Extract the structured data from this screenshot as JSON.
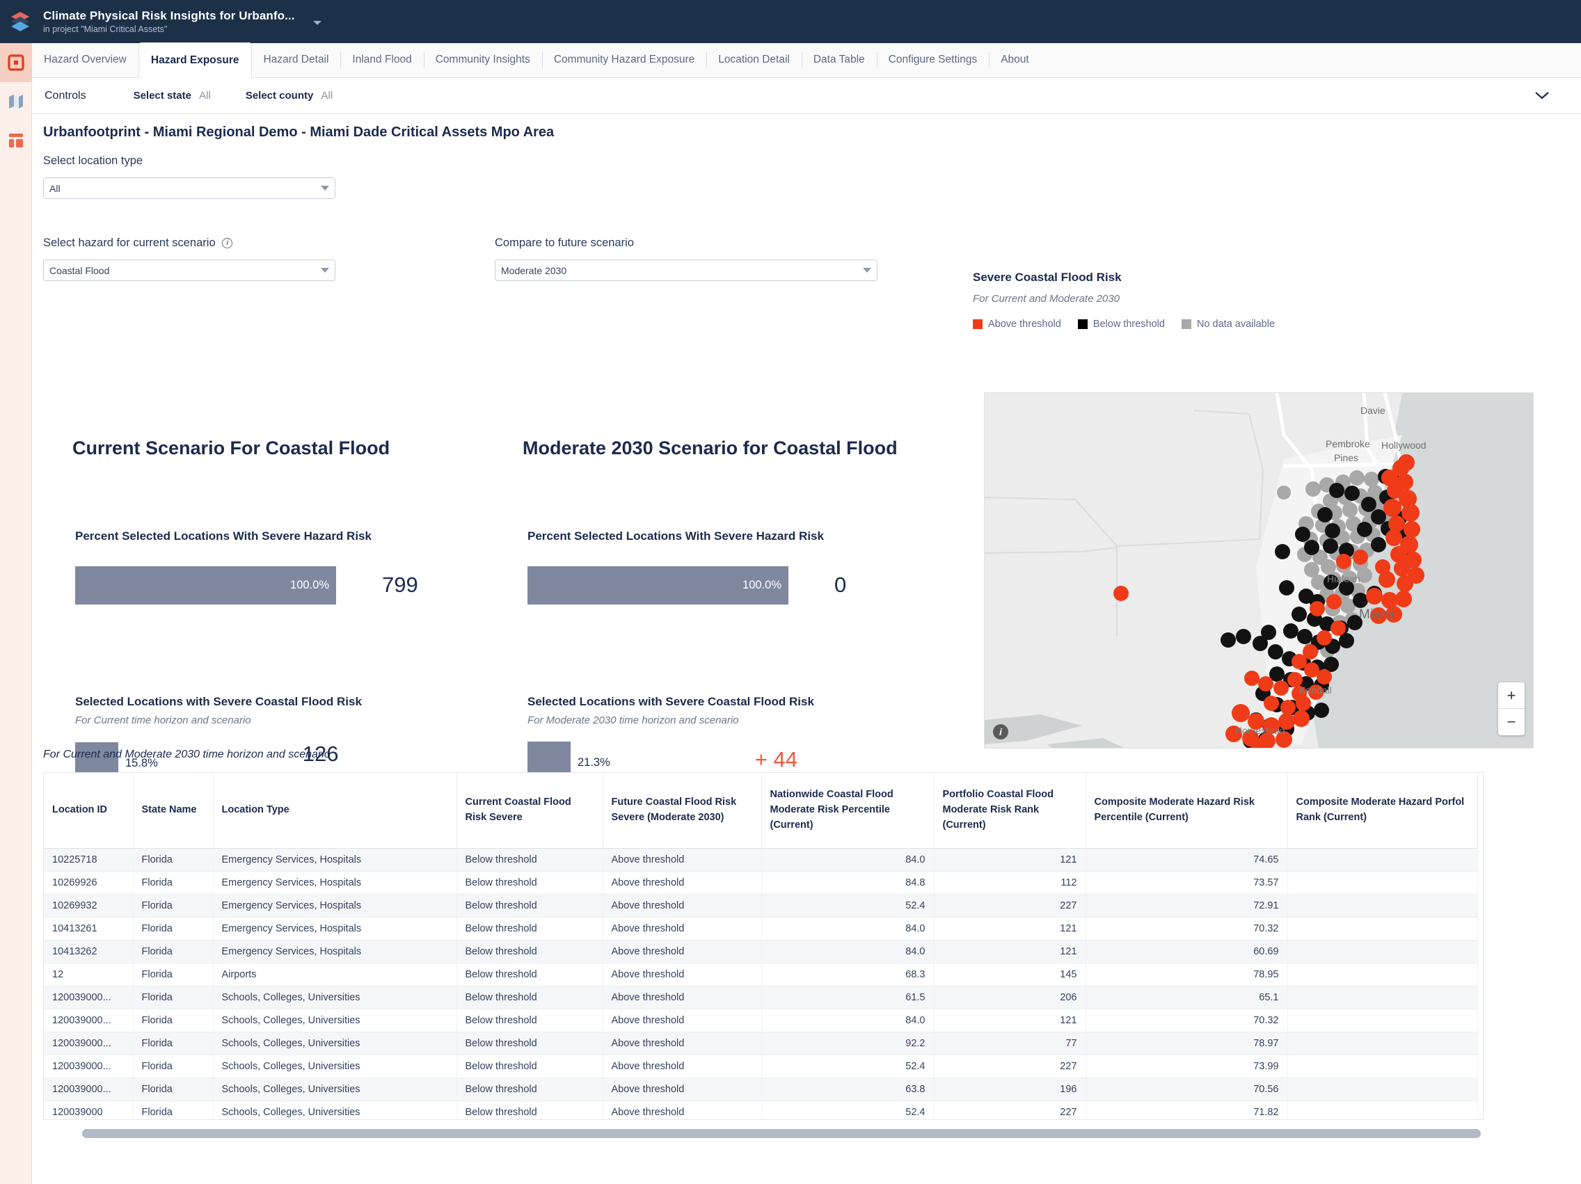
{
  "app": {
    "title": "Climate Physical Risk Insights for Urbanfo...",
    "subtitle": "in project \"Miami Critical Assets\"",
    "logo_icon": "layers-logo-icon",
    "title_caret_icon": "caret-down-icon"
  },
  "rail": {
    "items": [
      {
        "icon": "square-target-icon",
        "active": true
      },
      {
        "icon": "map-fold-icon",
        "active": false
      },
      {
        "icon": "dashboard-layout-icon",
        "active": false
      }
    ]
  },
  "tabs": [
    {
      "label": "Hazard Overview",
      "active": false
    },
    {
      "label": "Hazard Exposure",
      "active": true
    },
    {
      "label": "Hazard Detail",
      "active": false
    },
    {
      "label": "Inland Flood",
      "active": false
    },
    {
      "label": "Community Insights",
      "active": false
    },
    {
      "label": "Community Hazard Exposure",
      "active": false
    },
    {
      "label": "Location Detail",
      "active": false
    },
    {
      "label": "Data Table",
      "active": false
    },
    {
      "label": "Configure Settings",
      "active": false
    },
    {
      "label": "About",
      "active": false
    }
  ],
  "controls": {
    "label": "Controls",
    "filters": [
      {
        "name": "Select state",
        "value": "All"
      },
      {
        "name": "Select county",
        "value": "All"
      }
    ],
    "collapse_icon": "chevron-down-icon"
  },
  "page": {
    "title": "Urbanfootprint - Miami Regional Demo - Miami Dade Critical Assets Mpo Area"
  },
  "filters": {
    "location_type": {
      "label": "Select location type",
      "value": "All"
    },
    "hazard_current": {
      "label": "Select hazard for current scenario",
      "value": "Coastal Flood",
      "info_icon": "info-circle-icon"
    },
    "future_scenario": {
      "label": "Compare to future scenario",
      "value": "Moderate 2030"
    }
  },
  "scenarios": [
    {
      "heading": "Current Scenario For Coastal Flood",
      "kpi1": {
        "title": "Percent Selected Locations With Severe Hazard Risk",
        "bar_percent": "100.0%",
        "bar_fill": 100,
        "value": "799"
      },
      "kpi2": {
        "title": "Selected Locations with Severe Coastal Flood Risk",
        "subtitle": "For Current time horizon and scenario",
        "bar_percent": "15.8%",
        "bar_fill": 15.8,
        "value": "126",
        "value_is_delta": false
      }
    },
    {
      "heading": "Moderate 2030 Scenario for Coastal Flood",
      "kpi1": {
        "title": "Percent Selected Locations With Severe Hazard Risk",
        "bar_percent": "100.0%",
        "bar_fill": 100,
        "value": "0"
      },
      "kpi2": {
        "title": "Selected Locations with Severe Coastal Flood Risk",
        "subtitle": "For Moderate 2030 time horizon and scenario",
        "bar_percent": "21.3%",
        "bar_fill": 21.3,
        "value": "+ 44",
        "value_is_delta": true
      }
    }
  ],
  "map": {
    "title": "Severe Coastal Flood Risk",
    "subtitle": "For Current and Moderate 2030",
    "legend": [
      {
        "label": "Above threshold",
        "color": "#ef3b18"
      },
      {
        "label": "Below threshold",
        "color": "#000000"
      },
      {
        "label": "No data available",
        "color": "#a8a8a8"
      }
    ],
    "city_labels": [
      "Davie",
      "Pembroke Pines",
      "Hollywood",
      "Hialeah",
      "Miami",
      "Kendall",
      "Homestead"
    ],
    "zoom_in_icon": "plus-icon",
    "zoom_out_icon": "minus-icon",
    "zoom_in_label": "+",
    "zoom_out_label": "−",
    "attribution_icon": "info-icon"
  },
  "table": {
    "caption": "For Current and Moderate 2030 time horizon and scenario",
    "columns": [
      "Location ID",
      "State Name",
      "Location Type",
      "Current Coastal Flood Risk Severe",
      "Future Coastal Flood Risk Severe (Moderate 2030)",
      "Nationwide Coastal Flood Moderate Risk Percentile (Current)",
      "Portfolio Coastal Flood Moderate Risk Rank (Current)",
      "Composite Moderate Hazard Risk Percentile (Current)",
      "Composite Moderate Hazard Porfol Rank (Current)"
    ],
    "rows": [
      [
        "10225718",
        "Florida",
        "Emergency Services, Hospitals",
        "Below threshold",
        "Above threshold",
        "84.0",
        "121",
        "74.65",
        ""
      ],
      [
        "10269926",
        "Florida",
        "Emergency Services, Hospitals",
        "Below threshold",
        "Above threshold",
        "84.8",
        "112",
        "73.57",
        ""
      ],
      [
        "10269932",
        "Florida",
        "Emergency Services, Hospitals",
        "Below threshold",
        "Above threshold",
        "52.4",
        "227",
        "72.91",
        ""
      ],
      [
        "10413261",
        "Florida",
        "Emergency Services, Hospitals",
        "Below threshold",
        "Above threshold",
        "84.0",
        "121",
        "70.32",
        ""
      ],
      [
        "10413262",
        "Florida",
        "Emergency Services, Hospitals",
        "Below threshold",
        "Above threshold",
        "84.0",
        "121",
        "60.69",
        ""
      ],
      [
        "12",
        "Florida",
        "Airports",
        "Below threshold",
        "Above threshold",
        "68.3",
        "145",
        "78.95",
        ""
      ],
      [
        "120039000...",
        "Florida",
        "Schools, Colleges, Universities",
        "Below threshold",
        "Above threshold",
        "61.5",
        "206",
        "65.1",
        ""
      ],
      [
        "120039000...",
        "Florida",
        "Schools, Colleges, Universities",
        "Below threshold",
        "Above threshold",
        "84.0",
        "121",
        "70.32",
        ""
      ],
      [
        "120039000...",
        "Florida",
        "Schools, Colleges, Universities",
        "Below threshold",
        "Above threshold",
        "92.2",
        "77",
        "78.97",
        ""
      ],
      [
        "120039000...",
        "Florida",
        "Schools, Colleges, Universities",
        "Below threshold",
        "Above threshold",
        "52.4",
        "227",
        "73.99",
        ""
      ],
      [
        "120039000...",
        "Florida",
        "Schools, Colleges, Universities",
        "Below threshold",
        "Above threshold",
        "63.8",
        "196",
        "70.56",
        ""
      ],
      [
        "120039000",
        "Florida",
        "Schools, Colleges, Universities",
        "Below threshold",
        "Above threshold",
        "52.4",
        "227",
        "71.82",
        ""
      ]
    ]
  }
}
